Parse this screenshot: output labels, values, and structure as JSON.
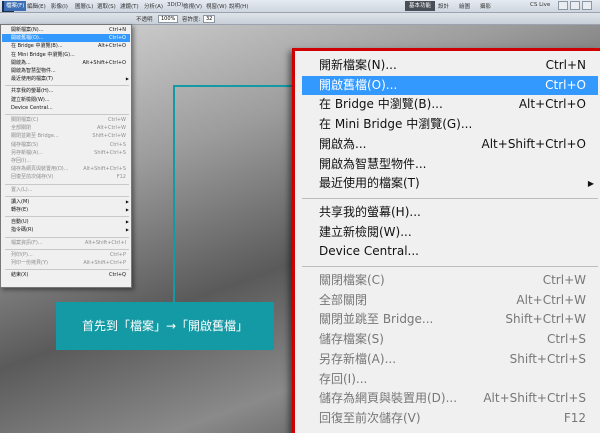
{
  "app": {
    "logo": "Ps"
  },
  "menubar": {
    "items": [
      {
        "label": "檔案(F)",
        "active": true
      },
      {
        "label": "編輯(E)"
      },
      {
        "label": "影像(I)"
      },
      {
        "label": "圖層(L)"
      },
      {
        "label": "選取(S)"
      },
      {
        "label": "濾鏡(T)"
      },
      {
        "label": "分析(A)"
      },
      {
        "label": "3D(D)"
      },
      {
        "label": "檢視(V)"
      },
      {
        "label": "視窗(W)"
      },
      {
        "label": "說明(H)"
      }
    ],
    "zoom": "100%",
    "workspace_button": "基本功能",
    "workspace_links": [
      "設計",
      "繪圖",
      "攝影"
    ],
    "cs_live": "CS Live"
  },
  "optionsbar": {
    "opacity_label": "不透明",
    "opacity_value": "100%",
    "tolerance_label": "容許度:",
    "tolerance_value": "32"
  },
  "small_menu": {
    "items": [
      {
        "label": "開新檔案(N)...",
        "shortcut": "Ctrl+N"
      },
      {
        "label": "開啟舊檔(O)...",
        "shortcut": "Ctrl+O",
        "highlight": true
      },
      {
        "label": "在 Bridge 中瀏覽(B)...",
        "shortcut": "Alt+Ctrl+O"
      },
      {
        "label": "在 Mini Bridge 中瀏覽(G)...",
        "shortcut": ""
      },
      {
        "label": "開啟為...",
        "shortcut": "Alt+Shift+Ctrl+O"
      },
      {
        "label": "開啟為智慧型物件...",
        "shortcut": ""
      },
      {
        "label": "最近使用的檔案(T)",
        "shortcut": "",
        "submenu": true
      },
      {
        "sep": true
      },
      {
        "label": "共享我的螢幕(H)...",
        "shortcut": ""
      },
      {
        "label": "建立新檢閱(W)...",
        "shortcut": ""
      },
      {
        "label": "Device Central...",
        "shortcut": ""
      },
      {
        "sep": true
      },
      {
        "label": "關閉檔案(C)",
        "shortcut": "Ctrl+W",
        "disabled": true
      },
      {
        "label": "全部關閉",
        "shortcut": "Alt+Ctrl+W",
        "disabled": true
      },
      {
        "label": "關閉並跳至 Bridge...",
        "shortcut": "Shift+Ctrl+W",
        "disabled": true
      },
      {
        "label": "儲存檔案(S)",
        "shortcut": "Ctrl+S",
        "disabled": true
      },
      {
        "label": "另存新檔(A)...",
        "shortcut": "Shift+Ctrl+S",
        "disabled": true
      },
      {
        "label": "存回(I)...",
        "shortcut": "",
        "disabled": true
      },
      {
        "label": "儲存為網頁與裝置用(D)...",
        "shortcut": "Alt+Shift+Ctrl+S",
        "disabled": true
      },
      {
        "label": "回復至前次儲存(V)",
        "shortcut": "F12",
        "disabled": true
      },
      {
        "sep": true
      },
      {
        "label": "置入(L)...",
        "shortcut": "",
        "disabled": true
      },
      {
        "sep": true
      },
      {
        "label": "讀入(M)",
        "shortcut": "",
        "submenu": true
      },
      {
        "label": "轉存(E)",
        "shortcut": "",
        "submenu": true
      },
      {
        "sep": true
      },
      {
        "label": "自動(U)",
        "shortcut": "",
        "submenu": true
      },
      {
        "label": "指令碼(R)",
        "shortcut": "",
        "submenu": true
      },
      {
        "sep": true
      },
      {
        "label": "檔案資訊(F)...",
        "shortcut": "Alt+Shift+Ctrl+I",
        "disabled": true
      },
      {
        "sep": true
      },
      {
        "label": "列印(P)...",
        "shortcut": "Ctrl+P",
        "disabled": true
      },
      {
        "label": "列印一份拷貝(Y)",
        "shortcut": "Alt+Shift+Ctrl+P",
        "disabled": true
      },
      {
        "sep": true
      },
      {
        "label": "結束(X)",
        "shortcut": "Ctrl+Q"
      }
    ]
  },
  "big_menu": {
    "items": [
      {
        "label": "開新檔案(N)...",
        "shortcut": "Ctrl+N"
      },
      {
        "label": "開啟舊檔(O)...",
        "shortcut": "Ctrl+O",
        "highlight": true
      },
      {
        "label": "在 Bridge 中瀏覽(B)...",
        "shortcut": "Alt+Ctrl+O"
      },
      {
        "label": "在 Mini Bridge 中瀏覽(G)...",
        "shortcut": ""
      },
      {
        "label": "開啟為...",
        "shortcut": "Alt+Shift+Ctrl+O"
      },
      {
        "label": "開啟為智慧型物件...",
        "shortcut": ""
      },
      {
        "label": "最近使用的檔案(T)",
        "shortcut": "",
        "submenu": true
      },
      {
        "sep": true
      },
      {
        "label": "共享我的螢幕(H)...",
        "shortcut": ""
      },
      {
        "label": "建立新檢閱(W)...",
        "shortcut": ""
      },
      {
        "label": "Device Central...",
        "shortcut": ""
      },
      {
        "sep": true
      },
      {
        "label": "關閉檔案(C)",
        "shortcut": "Ctrl+W",
        "disabled": true
      },
      {
        "label": "全部關閉",
        "shortcut": "Alt+Ctrl+W",
        "disabled": true
      },
      {
        "label": "關閉並跳至 Bridge...",
        "shortcut": "Shift+Ctrl+W",
        "disabled": true
      },
      {
        "label": "儲存檔案(S)",
        "shortcut": "Ctrl+S",
        "disabled": true
      },
      {
        "label": "另存新檔(A)...",
        "shortcut": "Shift+Ctrl+S",
        "disabled": true
      },
      {
        "label": "存回(I)...",
        "shortcut": "",
        "disabled": true
      },
      {
        "label": "儲存為網頁與裝置用(D)...",
        "shortcut": "Alt+Shift+Ctrl+S",
        "disabled": true
      },
      {
        "label": "回復至前次儲存(V)",
        "shortcut": "F12",
        "disabled": true
      }
    ]
  },
  "callout": {
    "text": "首先到「檔案」→「開啟舊檔」"
  },
  "colors": {
    "highlight": "#3399ff",
    "callout": "#139aa5",
    "frame": "#d10000"
  }
}
